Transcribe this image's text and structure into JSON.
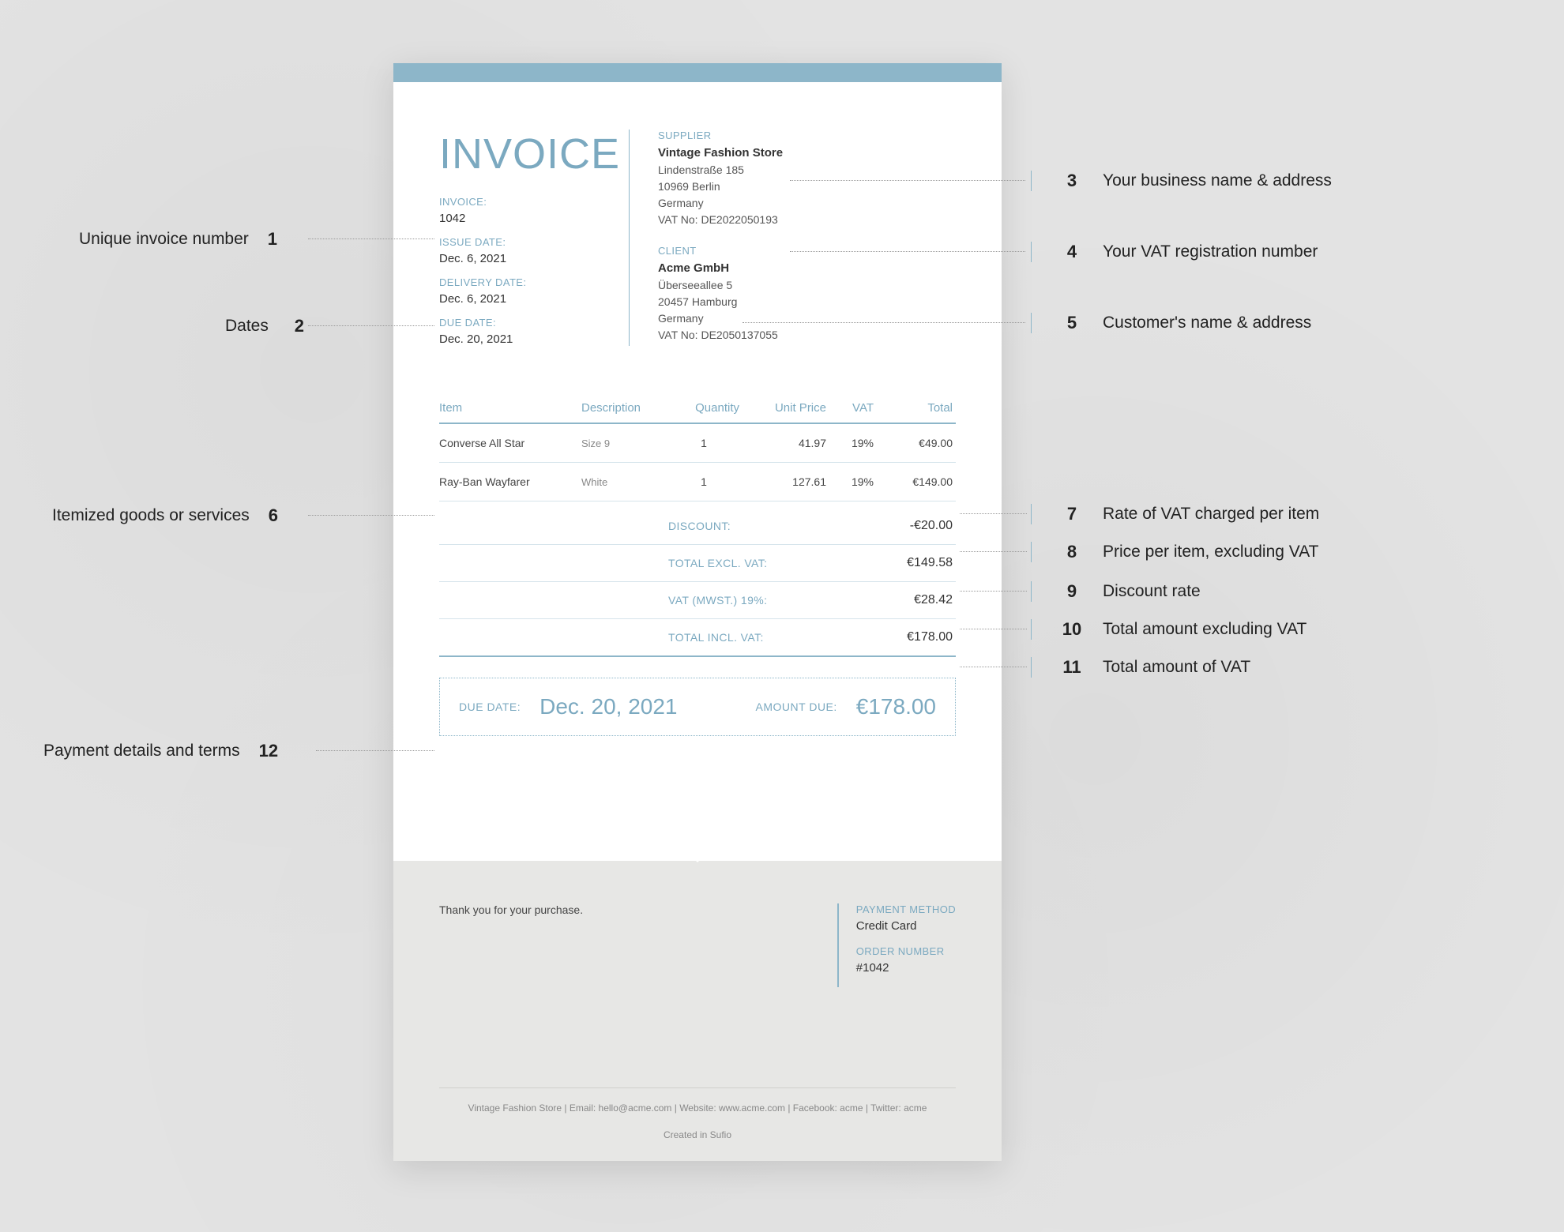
{
  "colors": {
    "accent": "#8db6c9"
  },
  "title": "INVOICE",
  "meta": {
    "invoice_label": "INVOICE:",
    "invoice_number": "1042",
    "issue_label": "ISSUE DATE:",
    "issue_date": "Dec. 6, 2021",
    "delivery_label": "DELIVERY DATE:",
    "delivery_date": "Dec. 6, 2021",
    "due_label": "DUE DATE:",
    "due_date": "Dec. 20, 2021"
  },
  "supplier": {
    "heading": "SUPPLIER",
    "name": "Vintage Fashion Store",
    "line1": "Lindenstraße 185",
    "line2": "10969 Berlin",
    "country": "Germany",
    "vat": "VAT No: DE2022050193"
  },
  "client": {
    "heading": "CLIENT",
    "name": "Acme GmbH",
    "line1": "Überseeallee 5",
    "line2": "20457 Hamburg",
    "country": "Germany",
    "vat": "VAT No: DE2050137055"
  },
  "columns": {
    "item": "Item",
    "desc": "Description",
    "qty": "Quantity",
    "unit": "Unit Price",
    "vat": "VAT",
    "total": "Total"
  },
  "items": [
    {
      "item": "Converse All Star",
      "desc": "Size 9",
      "qty": "1",
      "unit": "41.97",
      "vat": "19%",
      "total": "€49.00"
    },
    {
      "item": "Ray-Ban Wayfarer",
      "desc": "White",
      "qty": "1",
      "unit": "127.61",
      "vat": "19%",
      "total": "€149.00"
    }
  ],
  "summary": {
    "discount_label": "DISCOUNT:",
    "discount": "-€20.00",
    "excl_label": "TOTAL EXCL. VAT:",
    "excl": "€149.58",
    "vat_label": "VAT (MWST.) 19%:",
    "vat": "€28.42",
    "incl_label": "TOTAL INCL. VAT:",
    "incl": "€178.00"
  },
  "duebox": {
    "due_label": "DUE DATE:",
    "due_date": "Dec. 20, 2021",
    "amount_label": "AMOUNT DUE:",
    "amount": "€178.00"
  },
  "footer": {
    "thanks": "Thank you for your purchase.",
    "payment_label": "PAYMENT METHOD",
    "payment": "Credit Card",
    "order_label": "ORDER NUMBER",
    "order": "#1042",
    "contact": "Vintage Fashion Store   |   Email: hello@acme.com   |   Website: www.acme.com   |   Facebook: acme   |   Twitter: acme",
    "created": "Created in Sufio"
  },
  "annotations": {
    "n1": "Unique invoice number",
    "n2": "Dates",
    "n3": "Your business name & address",
    "n4": "Your VAT registration number",
    "n5": "Customer's name & address",
    "n6": "Itemized goods or services",
    "n7": "Rate of VAT charged per item",
    "n8": "Price per item, excluding VAT",
    "n9": "Discount rate",
    "n10": "Total amount excluding VAT",
    "n11": "Total amount of VAT",
    "n12": "Payment details and terms"
  }
}
